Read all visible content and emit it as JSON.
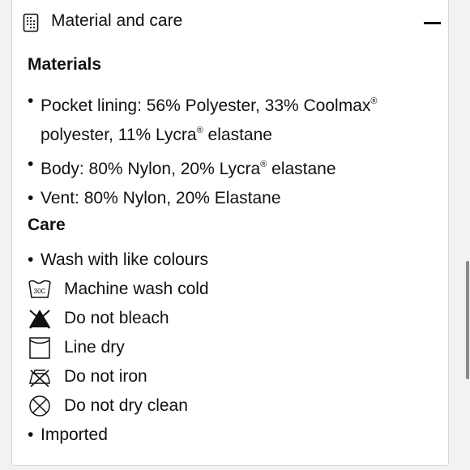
{
  "header": {
    "title": "Material and care",
    "icon": "clothing-tag-icon",
    "toggle_icon": "minus-icon"
  },
  "materials": {
    "title": "Materials",
    "items": [
      {
        "line1": "Pocket lining: 56% Polyester, 33% Coolmax",
        "mark1": "®",
        "line2a": "polyester, 11% Lycra",
        "mark2": "®",
        "line2b": " elastane"
      },
      {
        "a": "Body: 80% Nylon, 20% Lycra",
        "mark": "®",
        "b": " elastane"
      },
      {
        "text": "Vent: 80% Nylon, 20% Elastane"
      }
    ]
  },
  "care": {
    "title": "Care",
    "items": [
      {
        "text": "Wash with like colours",
        "icon": "bullet"
      },
      {
        "text": "Machine wash cold",
        "icon": "wash-30c-icon",
        "icon_text": "30C"
      },
      {
        "text": "Do not bleach",
        "icon": "do-not-bleach-icon"
      },
      {
        "text": "Line dry",
        "icon": "line-dry-icon"
      },
      {
        "text": "Do not iron",
        "icon": "do-not-iron-icon"
      },
      {
        "text": "Do not dry clean",
        "icon": "do-not-dry-clean-icon"
      },
      {
        "text": "Imported",
        "icon": "bullet"
      }
    ]
  }
}
